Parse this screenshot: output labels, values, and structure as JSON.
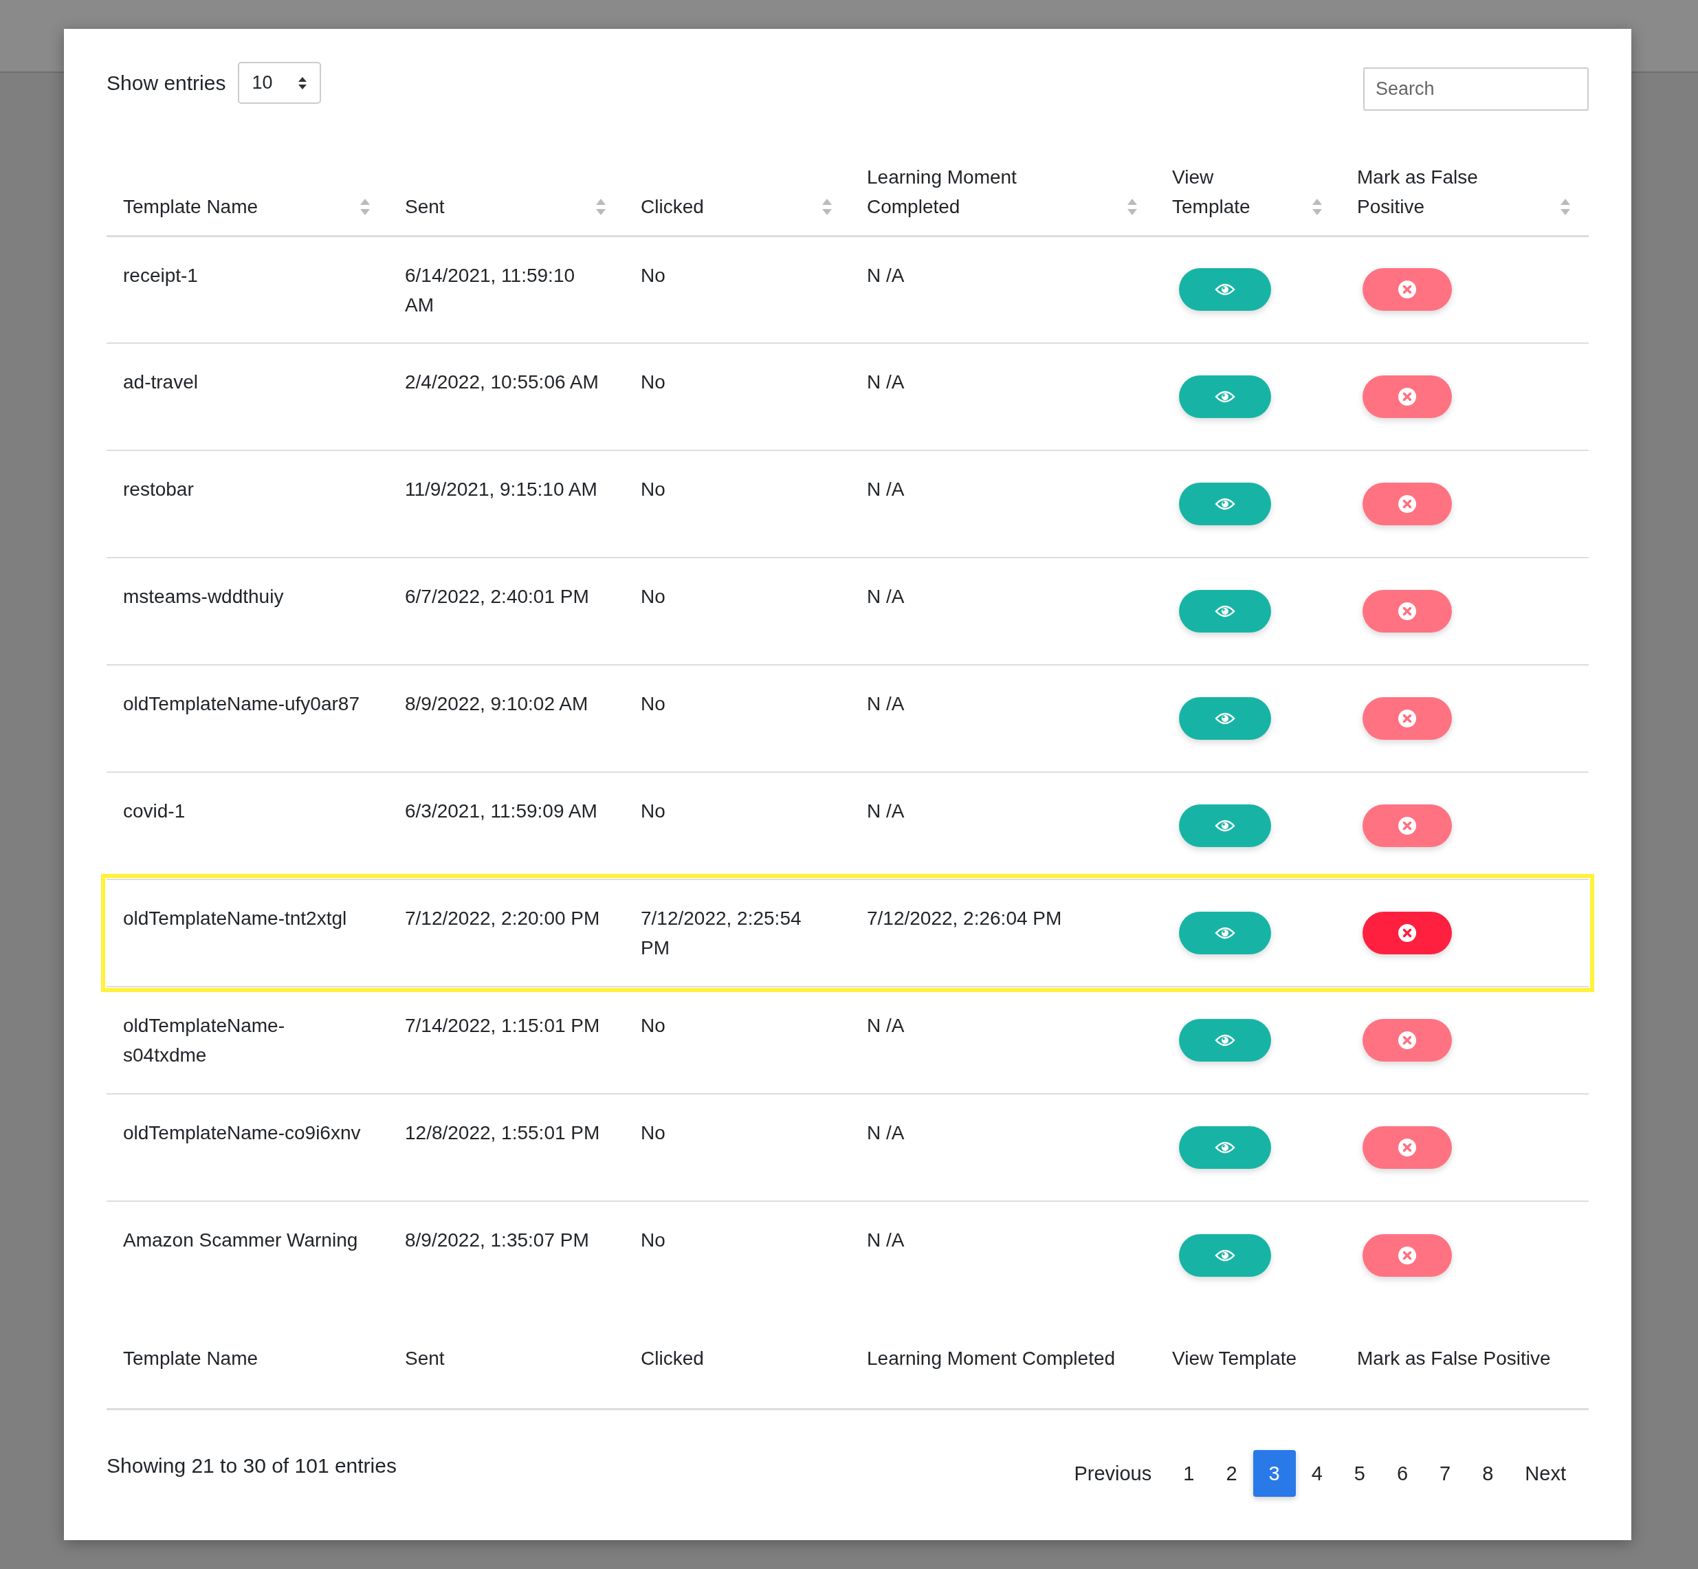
{
  "length_control": {
    "label": "Show entries",
    "value": "10"
  },
  "search": {
    "placeholder": "Search"
  },
  "table": {
    "columns": [
      {
        "label": "Template Name",
        "sortable": true
      },
      {
        "label": "Sent",
        "sortable": true
      },
      {
        "label": "Clicked",
        "sortable": true
      },
      {
        "label": "Learning Moment Completed",
        "sortable": true
      },
      {
        "label": "View Template",
        "sortable": true
      },
      {
        "label": "Mark as False Positive",
        "sortable": true
      }
    ],
    "rows": [
      {
        "template_name": "receipt-1",
        "sent": "6/14/2021, 11:59:10 AM",
        "clicked": "No",
        "learning_moment_completed": "N /A",
        "highlighted": false
      },
      {
        "template_name": "ad-travel",
        "sent": "2/4/2022, 10:55:06 AM",
        "clicked": "No",
        "learning_moment_completed": "N /A",
        "highlighted": false
      },
      {
        "template_name": "restobar",
        "sent": "11/9/2021, 9:15:10 AM",
        "clicked": "No",
        "learning_moment_completed": "N /A",
        "highlighted": false
      },
      {
        "template_name": "msteams-wddthuiy",
        "sent": "6/7/2022, 2:40:01 PM",
        "clicked": "No",
        "learning_moment_completed": "N /A",
        "highlighted": false
      },
      {
        "template_name": "oldTemplateName-ufy0ar87",
        "sent": "8/9/2022, 9:10:02 AM",
        "clicked": "No",
        "learning_moment_completed": "N /A",
        "highlighted": false
      },
      {
        "template_name": "covid-1",
        "sent": "6/3/2021, 11:59:09 AM",
        "clicked": "No",
        "learning_moment_completed": "N /A",
        "highlighted": false
      },
      {
        "template_name": "oldTemplateName-tnt2xtgl",
        "sent": "7/12/2022, 2:20:00 PM",
        "clicked": "7/12/2022, 2:25:54 PM",
        "learning_moment_completed": "7/12/2022, 2:26:04 PM",
        "highlighted": true
      },
      {
        "template_name": "oldTemplateName-s04txdme",
        "sent": "7/14/2022, 1:15:01 PM",
        "clicked": "No",
        "learning_moment_completed": "N /A",
        "highlighted": false
      },
      {
        "template_name": "oldTemplateName-co9i6xnv",
        "sent": "12/8/2022, 1:55:01 PM",
        "clicked": "No",
        "learning_moment_completed": "N /A",
        "highlighted": false
      },
      {
        "template_name": "Amazon Scammer Warning",
        "sent": "8/9/2022, 1:35:07 PM",
        "clicked": "No",
        "learning_moment_completed": "N /A",
        "highlighted": false
      }
    ],
    "footer_columns": [
      "Template Name",
      "Sent",
      "Clicked",
      "Learning Moment Completed",
      "View Template",
      "Mark as False Positive"
    ]
  },
  "info": "Showing 21 to 30 of 101 entries",
  "pagination": [
    {
      "label": "Previous",
      "selected": false
    },
    {
      "label": "1",
      "selected": false
    },
    {
      "label": "2",
      "selected": false
    },
    {
      "label": "3",
      "selected": true
    },
    {
      "label": "4",
      "selected": false
    },
    {
      "label": "5",
      "selected": false
    },
    {
      "label": "6",
      "selected": false
    },
    {
      "label": "7",
      "selected": false
    },
    {
      "label": "8",
      "selected": false
    },
    {
      "label": "Next",
      "selected": false
    }
  ]
}
